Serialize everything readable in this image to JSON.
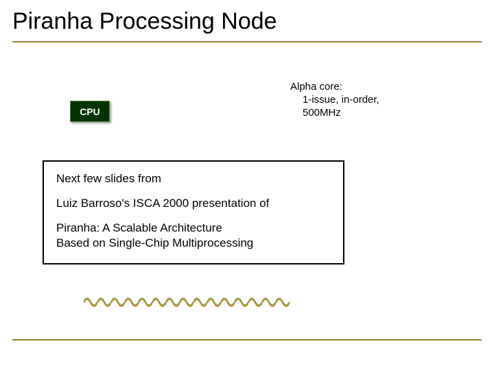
{
  "title": "Piranha Processing Node",
  "alpha_core": {
    "line1": "Alpha core:",
    "line2": "1-issue, in-order,",
    "line3": "500MHz"
  },
  "cpu_label": "CPU",
  "info": {
    "line1": "Next few slides from",
    "line2": "Luiz Barroso's ISCA 2000 presentation of",
    "line3a": "Piranha: A Scalable Architecture",
    "line3b": "Based on Single-Chip Multiprocessing"
  },
  "colors": {
    "accent": "#9a7a2e",
    "cpu_bg": "#003300"
  }
}
